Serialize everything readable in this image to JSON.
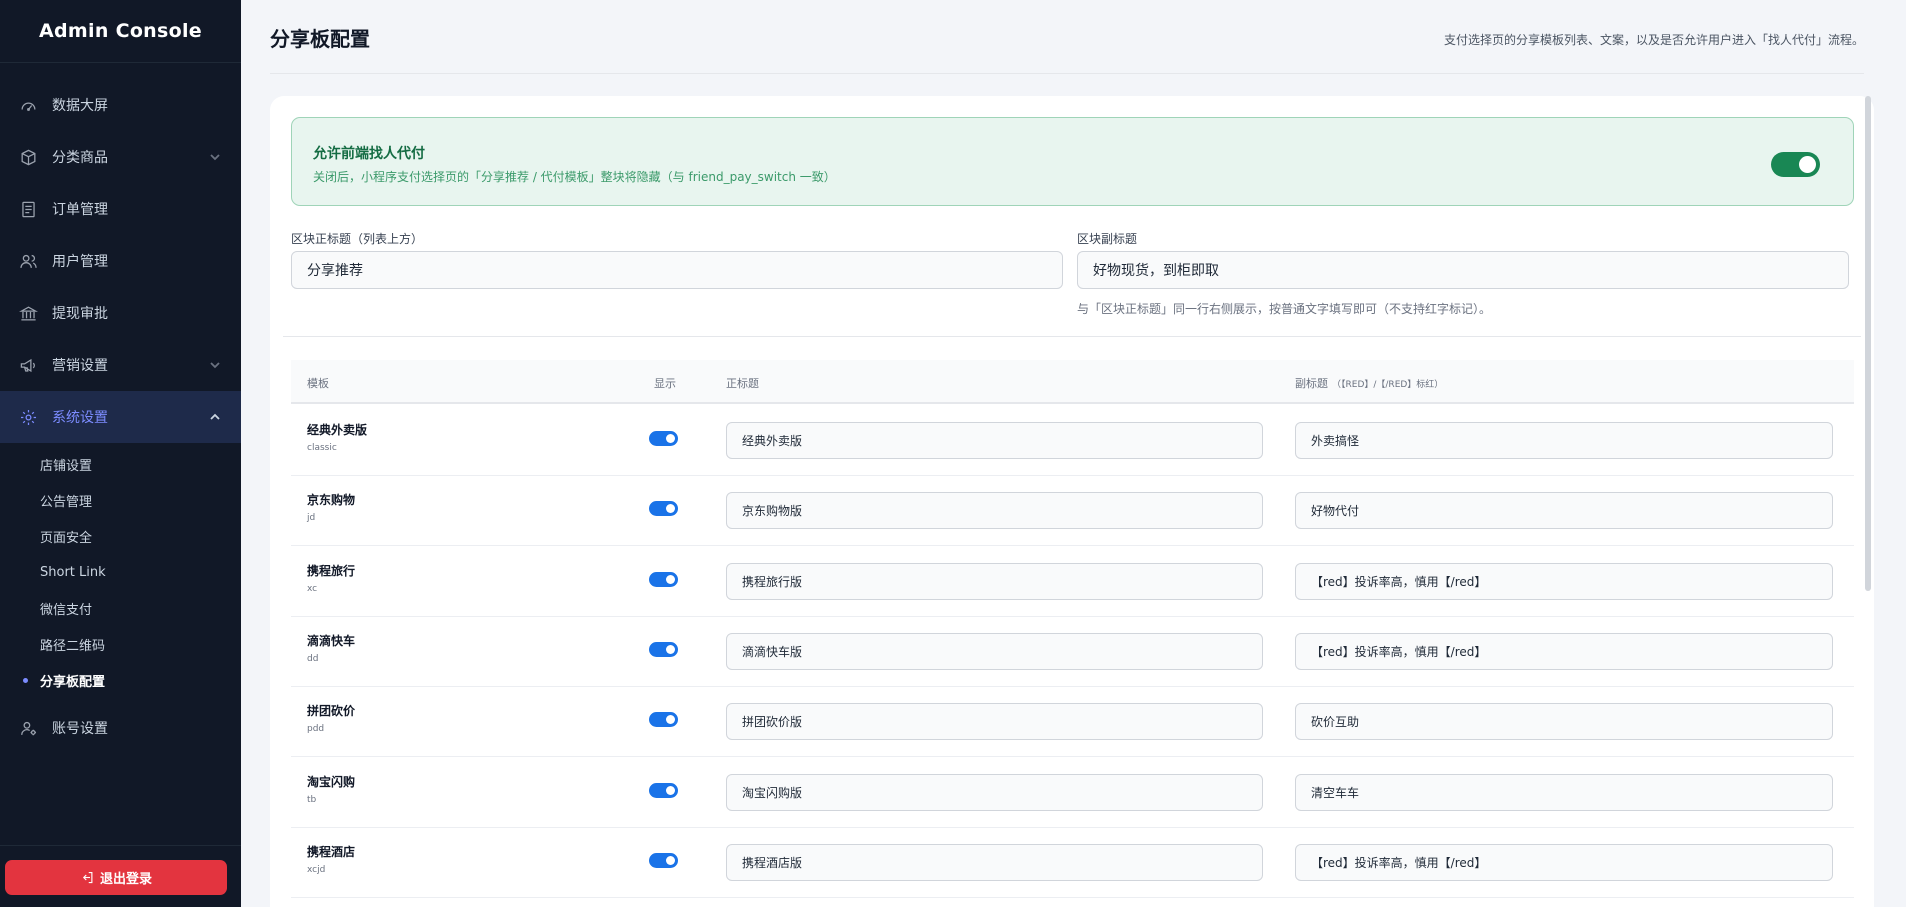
{
  "sidebar": {
    "brand": "Admin Console",
    "items": [
      {
        "label": "数据大屏",
        "icon": "gauge-icon"
      },
      {
        "label": "分类商品",
        "icon": "box-icon"
      },
      {
        "label": "订单管理",
        "icon": "receipt-icon"
      },
      {
        "label": "用户管理",
        "icon": "users-icon"
      },
      {
        "label": "提现审批",
        "icon": "bank-icon"
      },
      {
        "label": "营销设置",
        "icon": "megaphone-icon"
      },
      {
        "label": "系统设置",
        "icon": "gear-icon"
      },
      {
        "label": "账号设置",
        "icon": "user-gear-icon"
      }
    ],
    "sub_items": [
      "店铺设置",
      "公告管理",
      "页面安全",
      "Short Link",
      "微信支付",
      "路径二维码",
      "分享板配置"
    ],
    "logout": "退出登录"
  },
  "header": {
    "title": "分享板配置",
    "description": "支付选择页的分享模板列表、文案，以及是否允许用户进入「找人代付」流程。"
  },
  "banner": {
    "title": "允许前端找人代付",
    "description": "关闭后，小程序支付选择页的「分享推荐 / 代付模板」整块将隐藏（与 friend_pay_switch 一致）",
    "enabled": true
  },
  "form": {
    "main_title_label": "区块正标题（列表上方）",
    "main_title_value": "分享推荐",
    "sub_title_label": "区块副标题",
    "sub_title_value": "好物现货，到柜即取",
    "sub_title_hint": "与「区块正标题」同一行右侧展示，按普通文字填写即可（不支持红字标记）。"
  },
  "table": {
    "headers": {
      "template": "模板",
      "show": "显示",
      "title": "正标题",
      "subtitle": "副标题",
      "subtitle_note": "（【RED】/【/RED】标红）"
    },
    "rows": [
      {
        "name": "经典外卖版",
        "code": "classic",
        "show": true,
        "title": "经典外卖版",
        "subtitle": "外卖搞怪"
      },
      {
        "name": "京东购物",
        "code": "jd",
        "show": true,
        "title": "京东购物版",
        "subtitle": "好物代付"
      },
      {
        "name": "携程旅行",
        "code": "xc",
        "show": true,
        "title": "携程旅行版",
        "subtitle": "【red】投诉率高，慎用【/red】"
      },
      {
        "name": "滴滴快车",
        "code": "dd",
        "show": true,
        "title": "滴滴快车版",
        "subtitle": "【red】投诉率高，慎用【/red】"
      },
      {
        "name": "拼团砍价",
        "code": "pdd",
        "show": true,
        "title": "拼团砍价版",
        "subtitle": "砍价互助"
      },
      {
        "name": "淘宝闪购",
        "code": "tb",
        "show": true,
        "title": "淘宝闪购版",
        "subtitle": "清空车车"
      },
      {
        "name": "携程酒店",
        "code": "xcjd",
        "show": true,
        "title": "携程酒店版",
        "subtitle": "【red】投诉率高，慎用【/red】"
      }
    ]
  },
  "colors": {
    "sidebar_bg": "#111827",
    "accent": "#7c8cff",
    "success": "#198754",
    "toggle_on": "#1a73e8",
    "danger": "#e3343f"
  }
}
